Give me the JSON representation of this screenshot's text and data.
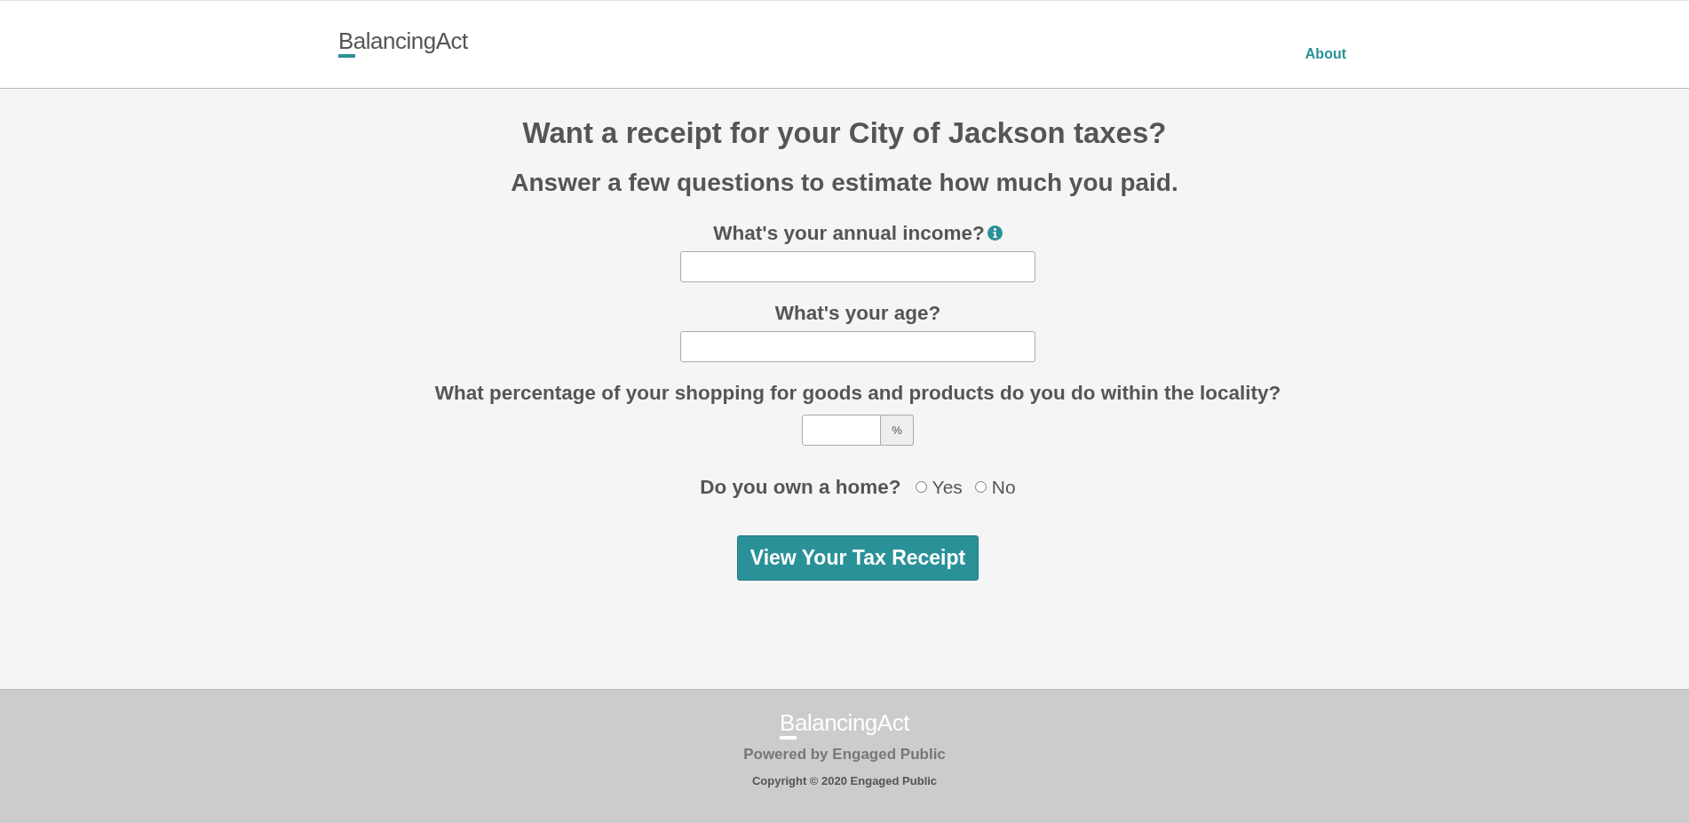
{
  "header": {
    "logo": "BalancingAct",
    "nav": [
      {
        "label": "About"
      }
    ]
  },
  "form": {
    "title": "Want a receipt for your City of Jackson taxes?",
    "subtitle": "Answer a few questions to estimate how much you paid.",
    "fields": [
      {
        "kind": "text",
        "label": "What's your annual income?",
        "info": true
      },
      {
        "kind": "text",
        "label": "What's your age?",
        "info": false
      },
      {
        "kind": "percent",
        "label": "What percentage of your shopping for goods and products do you do within the locality?",
        "addon": "%"
      },
      {
        "kind": "radio",
        "label": "Do you own a home?",
        "options": [
          {
            "label": "Yes",
            "selected": false
          },
          {
            "label": "No",
            "selected": false
          }
        ]
      }
    ],
    "submit": "View Your Tax Receipt"
  },
  "footer": {
    "logo": "BalancingAct",
    "powered_by": "Powered by Engaged Public",
    "copyright": "Copyright © 2020 Engaged Public"
  }
}
